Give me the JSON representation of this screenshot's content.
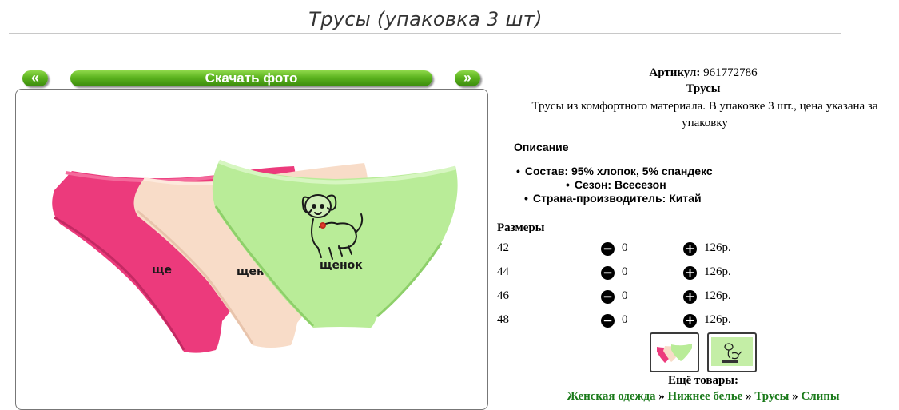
{
  "page": {
    "title": "Трусы (упаковка 3 шт)"
  },
  "gallery": {
    "prev_label": "«",
    "download_label": "Скачать фото",
    "next_label": "»",
    "print_label": "щенок",
    "print_label_partial_1": "щено",
    "print_label_partial_2": "ще"
  },
  "product": {
    "article_label": "Артикул:",
    "article_value": "961772786",
    "name": "Трусы",
    "description": "Трусы из комфортного материала. В упаковке 3 шт., цена указана за упаковку"
  },
  "details": {
    "heading": "Описание",
    "items": [
      "Состав: 95% хлопок, 5% спандекс",
      "Сезон: Всесезон",
      "Страна-производитель: Китай"
    ]
  },
  "sizes": {
    "heading": "Размеры",
    "rows": [
      {
        "size": "42",
        "qty": "0",
        "price": "126р."
      },
      {
        "size": "44",
        "qty": "0",
        "price": "126р."
      },
      {
        "size": "46",
        "qty": "0",
        "price": "126р."
      },
      {
        "size": "48",
        "qty": "0",
        "price": "126р."
      }
    ],
    "minus_symbol": "−",
    "plus_symbol": "+"
  },
  "thumbnails": [
    {
      "icon": "pack-thumbnail-icon",
      "selected": true
    },
    {
      "icon": "puppy-thumbnail-icon",
      "selected": false
    }
  ],
  "more": {
    "heading": "Ещё товары:",
    "breadcrumb": [
      "Женская одежда",
      "Нижнее белье",
      "Трусы",
      "Слипы"
    ],
    "separator": "»"
  },
  "colors": {
    "accent_green": "#5cb31f",
    "link_green": "#1a7a1a",
    "pink": "#ec3a7c",
    "peach": "#f8dcc8",
    "light_green": "#b9ec98"
  }
}
